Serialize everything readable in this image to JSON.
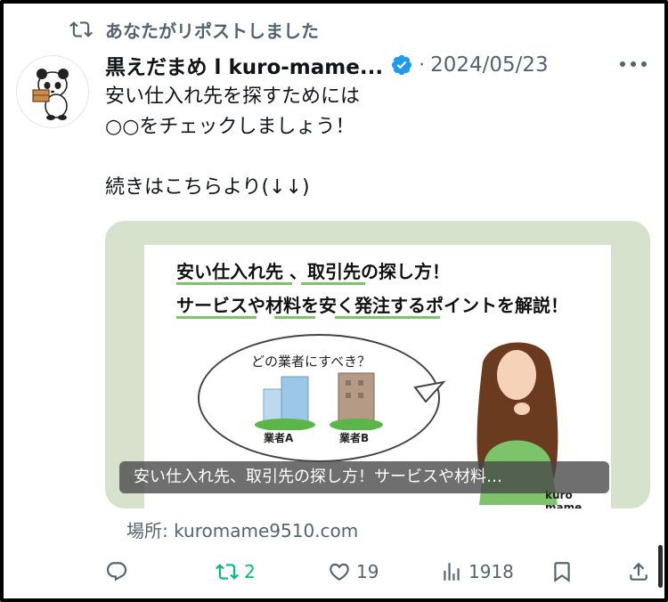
{
  "repost": {
    "label": "あなたがリポストしました"
  },
  "tweet": {
    "author_name": "黒えだまめ l kuro-mame...",
    "separator": "·",
    "date": "2024/05/23",
    "lines": [
      "安い仕入れ先を探すためには",
      "○○をチェックしましょう！",
      "",
      "続きはこちらより(↓↓)"
    ]
  },
  "card": {
    "image_title_line1": "安い仕入れ先 、取引先の探し方！",
    "image_title_line2": "サービスや材料を安く発注するポイントを解説！",
    "bubble_question": "どの業者にすべき？",
    "vendor_a": "業者A",
    "vendor_b": "業者B",
    "brand": "kuro mame",
    "caption": "安い仕入れ先、取引先の探し方！サービスや材料…",
    "location": "場所: kuromame9510.com"
  },
  "actions": {
    "reply_count": "",
    "repost_count": "2",
    "like_count": "19",
    "view_count": "1918"
  },
  "colors": {
    "repost_green": "#00ba7c",
    "muted": "#536471",
    "verified_blue": "#1d9bf0",
    "card_bg": "#d6e2cc"
  },
  "icons": [
    "repost-icon",
    "verified-icon",
    "more-icon",
    "reply-icon",
    "like-icon",
    "views-icon",
    "bookmark-icon",
    "share-icon"
  ]
}
